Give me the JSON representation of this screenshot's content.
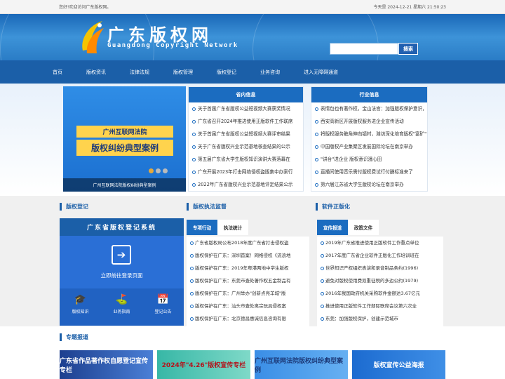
{
  "topbar": {
    "welcome": "您好!欢迎访问广东版权网。",
    "datetime": "今天是 2024-12-21 星期六 21:50:23"
  },
  "header": {
    "title": "广东版权网",
    "subtitle": "Guangdong Copyright Network",
    "search_placeholder": "",
    "search_button": "搜索"
  },
  "nav": [
    "首页",
    "版权资讯",
    "法律法规",
    "版权管理",
    "版权登记",
    "业务咨询",
    "进入无障碍通道"
  ],
  "slider": {
    "caption": "广州互联网法院版权纠纷典型案例",
    "line1": "广州互联网法院",
    "line2": "版权纠纷典型案例"
  },
  "province_news": {
    "title": "省内信息",
    "items": [
      "关于首届广东省版权公益短视频大赛获奖情况",
      "广东省召开2024年推进使用正版软件工作联席",
      "关于首届广东省版权公益短视频大赛评审结果",
      "关于广东省版权兴业示范基地核查结果的公示",
      "第五届广东省大学生版权知识演讲大赛落幕在",
      "广东开展2023年打击网络侵权盗版集中办案行",
      "2022年广东省版权兴业示范基地评定结果公示"
    ]
  },
  "industry_news": {
    "title": "行业信息",
    "items": [
      "表情包也有著作权，宝山法官：加强版权保护意识，",
      "西安高新区开展版权服务进企业宣传活动",
      "将版权服务触角伸向镇村，潍坊深化培育版权\"富矿\"",
      "中国版权产业集聚区发展国际论坛在南京举办",
      "\"讲台\"进企业 版权意识漫心田",
      "直播间使用音乐需付版权费试行付酬标准来了",
      "第六届江苏省大学生版权论坛在南京举办"
    ]
  },
  "registration": {
    "section_title": "版权登记",
    "box_title": "广东省版权登记系统",
    "login_text": "立即前往登录页面",
    "links": [
      "版权知识",
      "业务指南",
      "登记公告"
    ]
  },
  "enforcement": {
    "section_title": "版权执法监督",
    "tabs": [
      "专项行动",
      "执法统计"
    ],
    "items": [
      "广东省版权局公布2018年度广东省打击侵权盗",
      "版权保护在广东：深圳首案！网络侵权《流浪地",
      "版权保护在广东：2019年粤港两地中学生版权",
      "版权保护在广东：东莞市查处著作权五金制品有",
      "版权保护在广东：广州举办\"创新点亮羊城\"版",
      "版权保护在广东：汕头市查处离宗玩具侵权案",
      "版权保护在广东：北京德昌惠诚信息咨询有限"
    ]
  },
  "software": {
    "section_title": "软件正版化",
    "tabs": [
      "宣传报道",
      "政策文件"
    ],
    "items": [
      "2019年广东省推进使用正版软件工作重点单位",
      "2017年度广东省企业软件正版化工作培训班在",
      "世界知识产权组织表演和录音制品条约(1996)",
      "避免对版权使用费双重征税的多边公约(1979)",
      "2016年我国政府机关采购软件金额达3.67亿元",
      "推进使用正版软件工作部际联席会议第六次全",
      "东莞：加强版权保护，创建示范城市"
    ]
  },
  "special": {
    "section_title": "专题报道",
    "banners": [
      "广东省作品著作权自愿登记宣传专栏",
      "2024年\"4.26\"版权宣传专栏",
      "广州互联网法院版权纠纷典型案例",
      "版权宣传公益海报"
    ]
  }
}
